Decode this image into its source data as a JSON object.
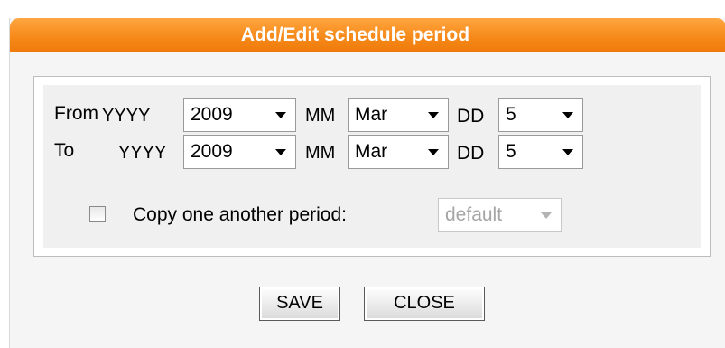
{
  "dialog": {
    "title": "Add/Edit schedule period"
  },
  "from": {
    "label": "From",
    "year_label": "YYYY",
    "year_value": "2009",
    "month_label": "MM",
    "month_value": "Mar",
    "day_label": "DD",
    "day_value": "5"
  },
  "to": {
    "label": "To",
    "year_label": "YYYY",
    "year_value": "2009",
    "month_label": "MM",
    "month_value": "Mar",
    "day_label": "DD",
    "day_value": "5"
  },
  "copy": {
    "checked": false,
    "label": "Copy one another period:",
    "select_value": "default",
    "disabled": true
  },
  "buttons": {
    "save_label": "SAVE",
    "close_label": "CLOSE"
  },
  "colors": {
    "title_bar": "#f68a1a",
    "title_text": "#ffffff",
    "panel_bg": "#f0f0f0",
    "dialog_bg": "#f5f5f5"
  }
}
